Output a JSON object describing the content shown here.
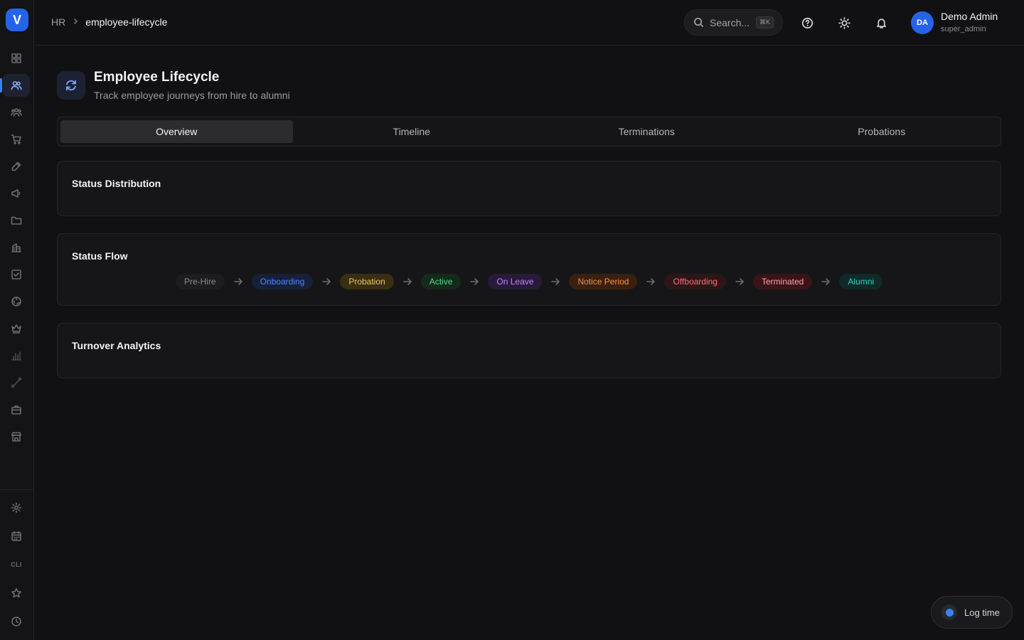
{
  "app": {
    "logo_letter": "V"
  },
  "sidebar": {
    "items": [
      {
        "icon": "grid-icon"
      },
      {
        "icon": "users-icon"
      },
      {
        "icon": "team-icon"
      },
      {
        "icon": "cart-icon"
      },
      {
        "icon": "pen-icon"
      },
      {
        "icon": "megaphone-icon"
      },
      {
        "icon": "folder-icon"
      },
      {
        "icon": "building-icon"
      },
      {
        "icon": "checkbox-icon"
      },
      {
        "icon": "globe-icon"
      },
      {
        "icon": "crown-icon"
      },
      {
        "icon": "bar-chart-icon"
      },
      {
        "icon": "route-icon"
      },
      {
        "icon": "briefcase-icon"
      },
      {
        "icon": "store-icon"
      }
    ],
    "bottom": {
      "settings_icon": "gear-icon",
      "calendar_icon": "calendar-icon",
      "cli_label": "CLI",
      "star_icon": "star-icon",
      "clock_icon": "clock-icon"
    }
  },
  "header": {
    "breadcrumb": {
      "parent": "HR",
      "current": "employee-lifecycle"
    },
    "search": {
      "placeholder": "Search...",
      "shortcut": "⌘K"
    },
    "user": {
      "initials": "DA",
      "name": "Demo Admin",
      "role": "super_admin"
    }
  },
  "page": {
    "title": "Employee Lifecycle",
    "subtitle": "Track employee journeys from hire to alumni"
  },
  "tabs": [
    {
      "label": "Overview",
      "active": true
    },
    {
      "label": "Timeline",
      "active": false
    },
    {
      "label": "Terminations",
      "active": false
    },
    {
      "label": "Probations",
      "active": false
    }
  ],
  "cards": {
    "status_distribution": {
      "title": "Status Distribution"
    },
    "status_flow": {
      "title": "Status Flow",
      "statuses": [
        {
          "label": "Pre-Hire",
          "color": "#8a8a92",
          "bg": "#1d1d20"
        },
        {
          "label": "Onboarding",
          "color": "#4f86f7",
          "bg": "#17203a"
        },
        {
          "label": "Probation",
          "color": "#e9c46a",
          "bg": "#3a2e12"
        },
        {
          "label": "Active",
          "color": "#4ade80",
          "bg": "#142a1c"
        },
        {
          "label": "On Leave",
          "color": "#c084fc",
          "bg": "#2a1a3a"
        },
        {
          "label": "Notice Period",
          "color": "#fb923c",
          "bg": "#3a2010"
        },
        {
          "label": "Offboarding",
          "color": "#f87171",
          "bg": "#2e1518"
        },
        {
          "label": "Terminated",
          "color": "#fca5a5",
          "bg": "#3a1418"
        },
        {
          "label": "Alumni",
          "color": "#2dd4bf",
          "bg": "#0f2a28"
        }
      ]
    },
    "turnover_analytics": {
      "title": "Turnover Analytics"
    }
  },
  "log_time": {
    "label": "Log time"
  }
}
